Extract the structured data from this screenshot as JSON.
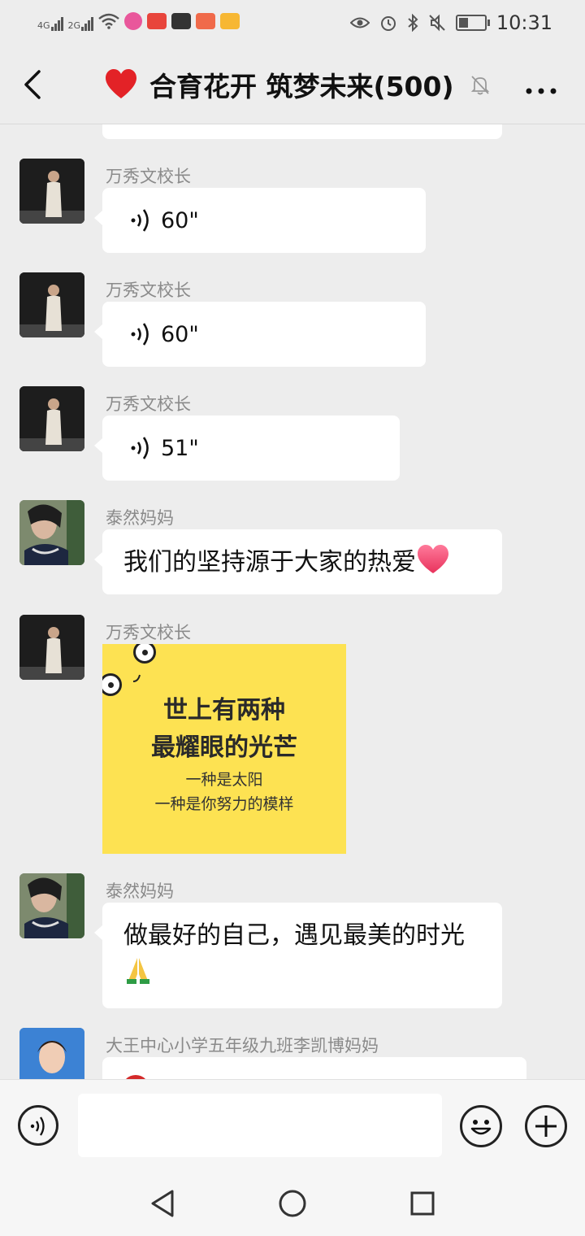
{
  "status_bar": {
    "network_1": "4G",
    "network_2": "2G",
    "time": "10:31",
    "battery_level": 0.35
  },
  "header": {
    "title": "合育花开 筑梦未来(500)",
    "title_emoji": "heart-emoji",
    "muted": true
  },
  "messages": [
    {
      "sender": "万秀文校长",
      "type": "voice",
      "duration": "60\""
    },
    {
      "sender": "万秀文校长",
      "type": "voice",
      "duration": "60\""
    },
    {
      "sender": "万秀文校长",
      "type": "voice",
      "duration": "51\""
    },
    {
      "sender": "泰然妈妈",
      "type": "text",
      "text": "我们的坚持源于大家的热爱",
      "trailing_emoji": "heart-emoji"
    },
    {
      "sender": "万秀文校长",
      "type": "image",
      "image_text": {
        "line1": "世上有两种",
        "line2": "最耀眼的光芒",
        "line3": "一种是太阳",
        "line4": "一种是你努力的模样"
      }
    },
    {
      "sender": "泰然妈妈",
      "type": "text",
      "text": "做最好的自己，遇见最美的时光",
      "trailing_emoji": "pray-emoji"
    },
    {
      "sender": "大王中心小学五年级九班李凯博妈妈",
      "type": "partial"
    }
  ],
  "input_bar": {
    "placeholder": "",
    "value": ""
  },
  "colors": {
    "background": "#ededed",
    "bubble": "#ffffff",
    "sender_name": "#8a8a8a",
    "image_bg": "#fde252"
  }
}
